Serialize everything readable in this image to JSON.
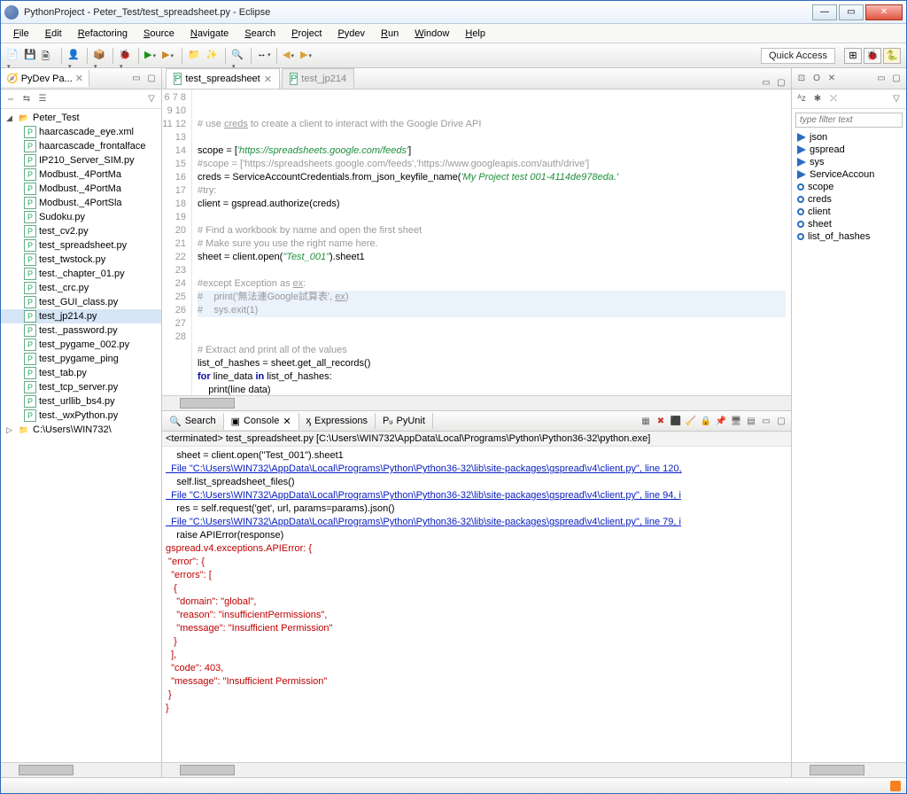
{
  "window": {
    "title": "PythonProject - Peter_Test/test_spreadsheet.py - Eclipse"
  },
  "menu": [
    "File",
    "Edit",
    "Refactoring",
    "Source",
    "Navigate",
    "Search",
    "Project",
    "Pydev",
    "Run",
    "Window",
    "Help"
  ],
  "quick_access": "Quick Access",
  "pydev_tab": "PyDev Pa...",
  "project_name": "Peter_Test",
  "files": [
    "haarcascade_eye.xml",
    "haarcascade_frontalface",
    "IP210_Server_SIM.py",
    "Modbust._4PortMa",
    "Modbust._4PortMa",
    "Modbust._4PortSla",
    "Sudoku.py",
    "test_cv2.py",
    "test_spreadsheet.py",
    "test_twstock.py",
    "test._chapter_01.py",
    "test._crc.py",
    "test_GUI_class.py",
    "test_jp214.py",
    "test._password.py",
    "test_pygame_002.py",
    "test_pygame_ping",
    "test_tab.py",
    "test_tcp_server.py",
    "test_urllib_bs4.py",
    "test._wxPython.py"
  ],
  "extra_node": "C:\\Users\\WIN732\\",
  "editor_tabs": [
    {
      "label": "test_spreadsheet",
      "active": true
    },
    {
      "label": "test_jp214",
      "active": false
    }
  ],
  "code_lines": [
    {
      "n": 6,
      "html": ""
    },
    {
      "n": 7,
      "html": ""
    },
    {
      "n": 8,
      "html": "<span class='c'># use <u>creds</u> to create a client to interact with the Google Drive API</span>"
    },
    {
      "n": 9,
      "html": ""
    },
    {
      "n": 10,
      "html": "<span class='n'>scope = [</span><span class='s'>'https://spreadsheets.google.com/feeds'</span><span class='n'>]</span>"
    },
    {
      "n": 11,
      "html": "<span class='c'>#scope = ['https://spreadsheets.google.com/feeds','https://www.googleapis.com/auth/drive']</span>"
    },
    {
      "n": 12,
      "html": "<span class='n'>creds = ServiceAccountCredentials.from_json_keyfile_name(</span><span class='s'>'My Project test 001-4114de978eda.'</span>"
    },
    {
      "n": 13,
      "html": "<span class='c'>#try:</span>"
    },
    {
      "n": 14,
      "html": "<span class='n'>client = gspread.authorize(creds)</span>"
    },
    {
      "n": 15,
      "html": ""
    },
    {
      "n": 16,
      "html": "<span class='c'># Find a workbook by name and open the first sheet</span>"
    },
    {
      "n": 17,
      "html": "<span class='c'># Make sure you use the right name here.</span>"
    },
    {
      "n": 18,
      "html": "<span class='n'>sheet = client.open(</span><span class='s'>\"Test_001\"</span><span class='n'>).sheet1</span>"
    },
    {
      "n": 19,
      "html": ""
    },
    {
      "n": 20,
      "html": "<span class='c'>#except Exception as <u>ex</u>:</span>"
    },
    {
      "n": 21,
      "html": "<span class='hl'><span class='c'>#    print('無法連Google試算表', <u>ex</u>)</span></span>"
    },
    {
      "n": 22,
      "html": "<span class='hl'><span class='c'>#    sys.exit(1)</span></span>"
    },
    {
      "n": 23,
      "html": ""
    },
    {
      "n": 24,
      "html": ""
    },
    {
      "n": 25,
      "html": "<span class='c'># Extract and print all of the values</span>"
    },
    {
      "n": 26,
      "html": "<span class='n'>list_of_hashes = sheet.get_all_records()</span>"
    },
    {
      "n": 27,
      "html": "<span class='k'>for</span><span class='n'> line_data </span><span class='k'>in</span><span class='n'> list_of_hashes:</span>"
    },
    {
      "n": 28,
      "html": "<span class='n'>    print(line data)</span>"
    }
  ],
  "bottom_tabs": [
    "Search",
    "Console",
    "Expressions",
    "PyUnit"
  ],
  "console_header": "<terminated> test_spreadsheet.py [C:\\Users\\WIN732\\AppData\\Local\\Programs\\Python\\Python36-32\\python.exe]",
  "console_lines": [
    {
      "cls": "k2",
      "t": "    sheet = client.open(\"Test_001\").sheet1"
    },
    {
      "cls": "b",
      "t": "  File \"C:\\Users\\WIN732\\AppData\\Local\\Programs\\Python\\Python36-32\\lib\\site-packages\\gspread\\v4\\client.py\", line 120,"
    },
    {
      "cls": "k2",
      "t": "    self.list_spreadsheet_files()"
    },
    {
      "cls": "b",
      "t": "  File \"C:\\Users\\WIN732\\AppData\\Local\\Programs\\Python\\Python36-32\\lib\\site-packages\\gspread\\v4\\client.py\", line 94, i"
    },
    {
      "cls": "k2",
      "t": "    res = self.request('get', url, params=params).json()"
    },
    {
      "cls": "b",
      "t": "  File \"C:\\Users\\WIN732\\AppData\\Local\\Programs\\Python\\Python36-32\\lib\\site-packages\\gspread\\v4\\client.py\", line 79, i"
    },
    {
      "cls": "k2",
      "t": "    raise APIError(response)"
    },
    {
      "cls": "r",
      "t": "gspread.v4.exceptions.APIError: {"
    },
    {
      "cls": "r",
      "t": " \"error\": {"
    },
    {
      "cls": "r",
      "t": "  \"errors\": ["
    },
    {
      "cls": "r",
      "t": "   {"
    },
    {
      "cls": "r",
      "t": "    \"domain\": \"global\","
    },
    {
      "cls": "r",
      "t": "    \"reason\": \"insufficientPermissions\","
    },
    {
      "cls": "r",
      "t": "    \"message\": \"Insufficient Permission\""
    },
    {
      "cls": "r",
      "t": "   }"
    },
    {
      "cls": "r",
      "t": "  ],"
    },
    {
      "cls": "r",
      "t": "  \"code\": 403,"
    },
    {
      "cls": "r",
      "t": "  \"message\": \"Insufficient Permission\""
    },
    {
      "cls": "r",
      "t": " }"
    },
    {
      "cls": "r",
      "t": "}"
    }
  ],
  "outline_filter": "type filter text",
  "outline": [
    {
      "k": "imp",
      "t": "json"
    },
    {
      "k": "imp",
      "t": "gspread"
    },
    {
      "k": "imp",
      "t": "sys"
    },
    {
      "k": "imp",
      "t": "ServiceAccoun"
    },
    {
      "k": "var",
      "t": "scope"
    },
    {
      "k": "var",
      "t": "creds"
    },
    {
      "k": "var",
      "t": "client"
    },
    {
      "k": "var",
      "t": "sheet"
    },
    {
      "k": "var",
      "t": "list_of_hashes"
    }
  ]
}
